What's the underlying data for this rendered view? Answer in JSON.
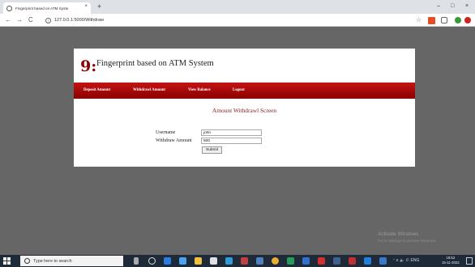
{
  "browser": {
    "tab_title": "Fingerprint based on ATM Syste",
    "tab_close": "×",
    "new_tab": "+",
    "url": "127.0.0.1:5000/Withdraw",
    "back": "←",
    "forward": "→",
    "reload": "C",
    "info": "i",
    "star": "☆",
    "minimize": "–",
    "maximize": "□",
    "close": "×"
  },
  "page": {
    "logo": "9:",
    "site_title": "Fingerprint based on ATM System",
    "nav": [
      {
        "label": "Deposit Amount"
      },
      {
        "label": "Withdrawl Amount"
      },
      {
        "label": "View Balance"
      },
      {
        "label": "Logout"
      }
    ],
    "screen_title": "Amount Withdrawl Screen",
    "form": {
      "username_label": "Username",
      "username_value": "john",
      "amount_label": "Withdraw Amount",
      "amount_value": "500",
      "submit_label": "Submit"
    }
  },
  "watermark": {
    "line1": "Activate Windows",
    "line2": "Go to Settings to activate Windows."
  },
  "taskbar": {
    "search_placeholder": "Type here to search",
    "tray_text": "ᵔ ∧ 🔈 //. ENG",
    "time": "18:52",
    "date": "15-11-2022"
  },
  "colors": {
    "navbar": "#b00000",
    "title_red": "#8b1a1a",
    "backdrop": "#666666"
  }
}
